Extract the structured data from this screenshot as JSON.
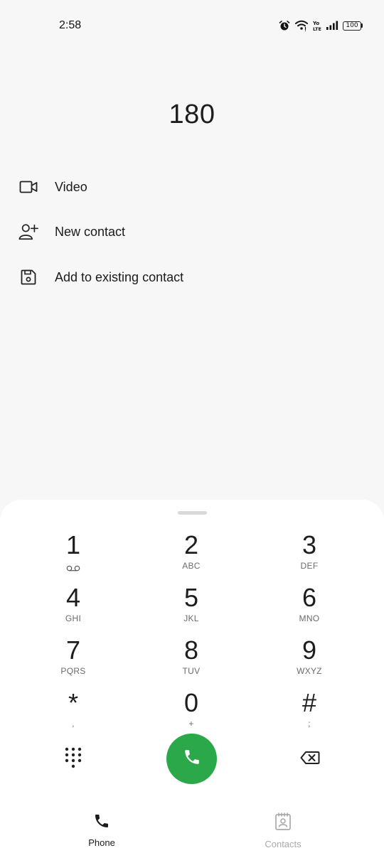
{
  "status_bar": {
    "time": "2:58",
    "battery": "100",
    "icons": [
      "alarm-icon",
      "wifi-icon",
      "volte-icon",
      "signal-icon",
      "battery-icon"
    ]
  },
  "dialer": {
    "number": "180"
  },
  "actions": [
    {
      "label": "Video",
      "icon": "video-camera-icon"
    },
    {
      "label": "New contact",
      "icon": "add-person-icon"
    },
    {
      "label": "Add to existing contact",
      "icon": "save-icon"
    }
  ],
  "keypad": {
    "keys": [
      {
        "digit": "1",
        "letters": ""
      },
      {
        "digit": "2",
        "letters": "ABC"
      },
      {
        "digit": "3",
        "letters": "DEF"
      },
      {
        "digit": "4",
        "letters": "GHI"
      },
      {
        "digit": "5",
        "letters": "JKL"
      },
      {
        "digit": "6",
        "letters": "MNO"
      },
      {
        "digit": "7",
        "letters": "PQRS"
      },
      {
        "digit": "8",
        "letters": "TUV"
      },
      {
        "digit": "9",
        "letters": "WXYZ"
      },
      {
        "digit": "*",
        "letters": ","
      },
      {
        "digit": "0",
        "letters": "+"
      },
      {
        "digit": "#",
        "letters": ";"
      }
    ]
  },
  "colors": {
    "call_green": "#2aa84a",
    "background": "#f7f7f7",
    "sheet": "#ffffff"
  },
  "nav": {
    "phone_label": "Phone",
    "contacts_label": "Contacts"
  }
}
